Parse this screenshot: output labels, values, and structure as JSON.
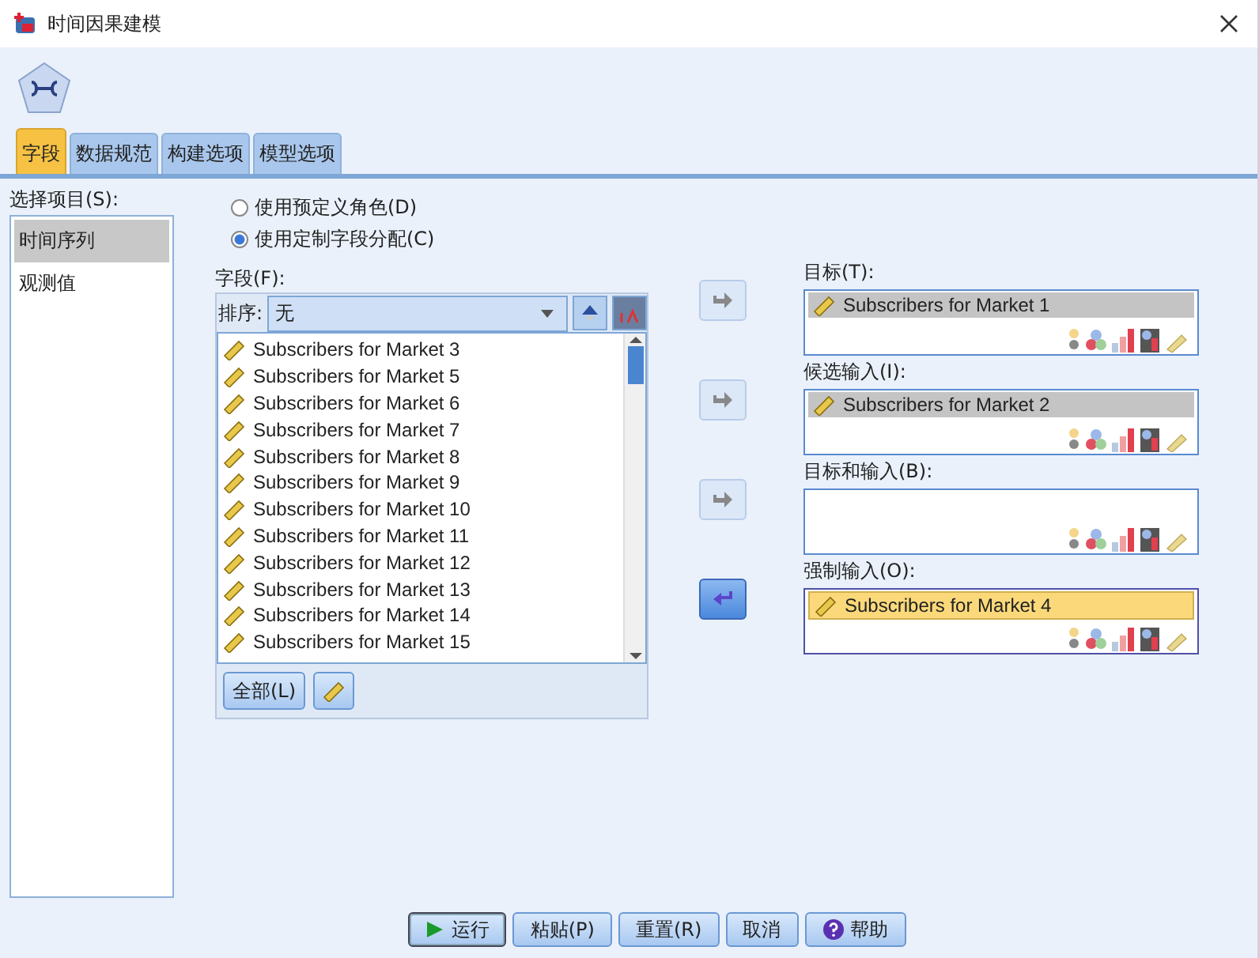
{
  "window": {
    "title": "时间因果建模"
  },
  "tabs": [
    {
      "label": "字段",
      "selected": true
    },
    {
      "label": "数据规范",
      "selected": false
    },
    {
      "label": "构建选项",
      "selected": false
    },
    {
      "label": "模型选项",
      "selected": false
    }
  ],
  "sidebar": {
    "label": "选择项目(S):",
    "items": [
      {
        "label": "时间序列",
        "selected": true
      },
      {
        "label": "观测值",
        "selected": false
      }
    ]
  },
  "radios": [
    {
      "label": "使用预定义角色(D)",
      "selected": false
    },
    {
      "label": "使用定制字段分配(C)",
      "selected": true
    }
  ],
  "fields": {
    "label": "字段(F):",
    "sort_label": "排序:",
    "sort_value": "无",
    "items": [
      "Subscribers for Market 3",
      "Subscribers for Market 5",
      "Subscribers for Market 6",
      "Subscribers for Market 7",
      "Subscribers for Market 8",
      "Subscribers for Market 9",
      "Subscribers for Market 10",
      "Subscribers for Market 11",
      "Subscribers for Market 12",
      "Subscribers for Market 13",
      "Subscribers for Market 14",
      "Subscribers for Market 15"
    ],
    "all_button": "全部(L)"
  },
  "roles": [
    {
      "label": "目标(T):",
      "kind": "add",
      "move_disabled": true,
      "items": [
        {
          "name": "Subscribers for Market 1",
          "selected": false
        }
      ]
    },
    {
      "label": "候选输入(I):",
      "kind": "add",
      "move_disabled": true,
      "items": [
        {
          "name": "Subscribers for Market 2",
          "selected": false
        }
      ]
    },
    {
      "label": "目标和输入(B):",
      "kind": "add",
      "move_disabled": true
    },
    {
      "label": "强制输入(O):",
      "kind": "remove",
      "move_disabled": false,
      "items": [
        {
          "name": "Subscribers for Market 4",
          "selected": true
        }
      ]
    }
  ],
  "buttons": [
    {
      "label": "运行",
      "kind": "run"
    },
    {
      "label": "粘贴(P)",
      "kind": "plain"
    },
    {
      "label": "重置(R)",
      "kind": "plain"
    },
    {
      "label": "取消",
      "kind": "plain"
    },
    {
      "label": "帮助",
      "kind": "help"
    }
  ]
}
